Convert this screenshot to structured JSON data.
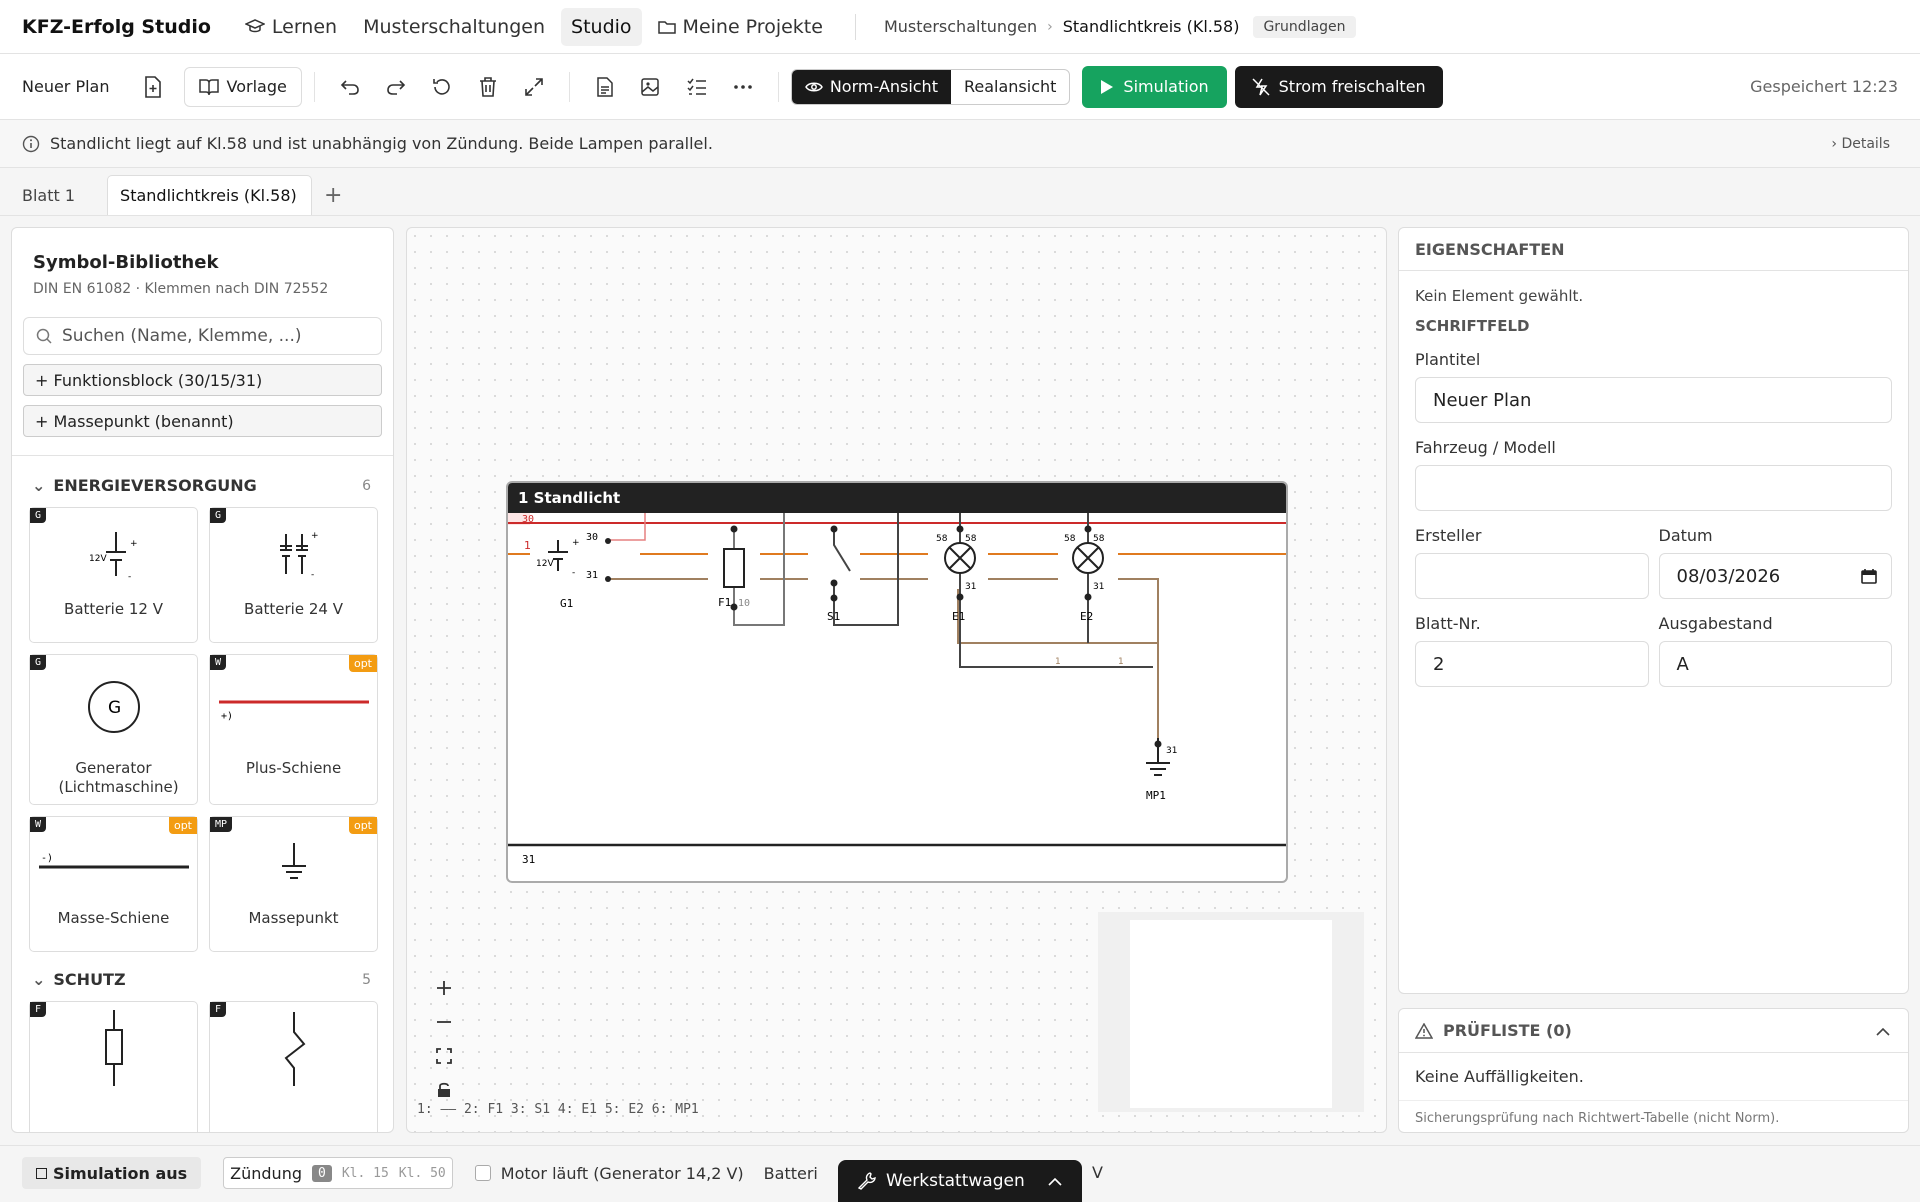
{
  "nav": {
    "brand": "KFZ-Erfolg Studio",
    "items": [
      {
        "label": "Lernen",
        "icon": "graduation-cap-icon"
      },
      {
        "label": "Musterschaltungen"
      },
      {
        "label": "Studio",
        "active": true
      },
      {
        "label": "Meine Projekte",
        "icon": "folder-icon"
      }
    ],
    "breadcrumb": {
      "parent": "Musterschaltungen",
      "current": "Standlichtkreis (Kl.58)",
      "badge": "Grundlagen"
    }
  },
  "toolbar": {
    "plan_name": "Neuer Plan",
    "template_label": "Vorlage",
    "view_norm": "Norm-Ansicht",
    "view_real": "Realansicht",
    "simulation_label": "Simulation",
    "power_label": "Strom freischalten",
    "saved": "Gespeichert 12:23"
  },
  "info": {
    "text": "Standlicht liegt auf Kl.58 und ist unabhängig von Zündung. Beide Lampen parallel.",
    "details": "Details"
  },
  "tabs": [
    "Blatt 1",
    "Standlichtkreis (Kl.58)"
  ],
  "library": {
    "title": "Symbol-Bibliothek",
    "subtitle": "DIN EN 61082 · Klemmen nach DIN 72552",
    "search_placeholder": "Suchen (Name, Klemme, ...)",
    "add_buttons": [
      "+ Funktionsblock (30/15/31)",
      "+ Massepunkt (benannt)"
    ],
    "sections": [
      {
        "title": "ENERGIEVERSORGUNG",
        "count": "6",
        "items": [
          {
            "tag": "G",
            "label": "Batterie 12 V",
            "sym_text": "12V"
          },
          {
            "tag": "G",
            "label": "Batterie 24 V"
          },
          {
            "tag": "G",
            "label": "Generator (Lichtmaschine)",
            "sym_text": "G"
          },
          {
            "tag": "W",
            "label": "Plus-Schiene",
            "opt": "opt",
            "sym_text": "+)"
          },
          {
            "tag": "W",
            "label": "Masse-Schiene",
            "opt": "opt",
            "sym_text": "-)"
          },
          {
            "tag": "MP",
            "label": "Massepunkt",
            "opt": "opt"
          }
        ]
      },
      {
        "title": "SCHUTZ",
        "count": "5",
        "items": [
          {
            "tag": "F",
            "label": ""
          },
          {
            "tag": "F",
            "label": ""
          }
        ]
      }
    ]
  },
  "diagram": {
    "frame_title": "1 Standlicht",
    "rail_top": "30",
    "rail_bottom": "31",
    "wire_num": "1",
    "battery": {
      "id": "G1",
      "volt": "12V",
      "plus": "+",
      "minus": "-",
      "t30": "30",
      "t31": "31"
    },
    "fuse": {
      "id": "F1",
      "rating": "10"
    },
    "switch": {
      "id": "S1"
    },
    "lamps": [
      {
        "id": "E1",
        "tl": "58",
        "tr": "58",
        "b": "31"
      },
      {
        "id": "E2",
        "tl": "58",
        "tr": "58",
        "b": "31"
      }
    ],
    "ground": {
      "id": "MP1",
      "t": "31"
    },
    "wire_labels": [
      "1",
      "1"
    ],
    "legend": "1: ‒‒ 2: F1 3: S1 4: E1 5: E2 6: MP1"
  },
  "properties": {
    "title": "EIGENSCHAFTEN",
    "note": "Kein Element gewählt.",
    "section": "SCHRIFTFELD",
    "fields": {
      "plantitel_label": "Plantitel",
      "plantitel": "Neuer Plan",
      "fahrzeug_label": "Fahrzeug / Modell",
      "fahrzeug": "",
      "ersteller_label": "Ersteller",
      "ersteller": "",
      "datum_label": "Datum",
      "datum": "08/03/2026",
      "blatt_label": "Blatt-Nr.",
      "blatt": "2",
      "ausgabe_label": "Ausgabestand",
      "ausgabe": "A"
    }
  },
  "checklist": {
    "title": "PRÜFLISTE (0)",
    "body": "Keine Auffälligkeiten.",
    "footer": "Sicherungsprüfung nach Richtwert-Tabelle (nicht Norm)."
  },
  "bottom": {
    "sim_off": "Simulation aus",
    "ignition_label": "Zündung",
    "ign_positions": [
      "0",
      "Kl. 15",
      "Kl. 50"
    ],
    "motor_label": "Motor läuft (Generator 14,2 V)",
    "battery_label": "Batteri",
    "volt_unit": "V",
    "workshop": "Werkstattwagen"
  },
  "colors": {
    "plus_rail": "#cc2a2a",
    "wire_58": "#e07a1f",
    "wire_31": "#a08060",
    "accent_green": "#16a35f"
  }
}
